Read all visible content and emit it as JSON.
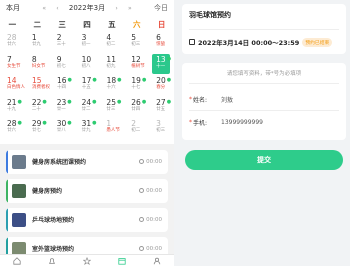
{
  "calendar": {
    "view_label": "本月",
    "prev_year": "«",
    "prev_month": "‹",
    "month_label": "2022年3月",
    "next_month": "›",
    "next_year": "»",
    "today_label": "今日",
    "weekdays": [
      "一",
      "二",
      "三",
      "四",
      "五",
      "六",
      "日"
    ],
    "weeks": [
      [
        {
          "num": "28",
          "sub": "廿六",
          "other": true
        },
        {
          "num": "1",
          "sub": "廿九"
        },
        {
          "num": "2",
          "sub": "三十"
        },
        {
          "num": "3",
          "sub": "初一"
        },
        {
          "num": "4",
          "sub": "初二"
        },
        {
          "num": "5",
          "sub": "初三"
        },
        {
          "num": "6",
          "sub": "惊蛰",
          "sub_red": true
        }
      ],
      [
        {
          "num": "7",
          "sub": "女生节",
          "sub_red": true
        },
        {
          "num": "8",
          "sub": "妇女节",
          "sub_red": true
        },
        {
          "num": "9",
          "sub": "初七"
        },
        {
          "num": "10",
          "sub": "初八"
        },
        {
          "num": "11",
          "sub": "初九"
        },
        {
          "num": "12",
          "sub": "植树节",
          "sub_red": true
        },
        {
          "num": "13",
          "sub": "十一",
          "selected": true,
          "dot": true
        }
      ],
      [
        {
          "num": "14",
          "sub": "白色情人",
          "sub_red": true,
          "num_red": true
        },
        {
          "num": "15",
          "sub": "消费者权",
          "sub_red": true,
          "num_red": true
        },
        {
          "num": "16",
          "sub": "十四",
          "dot": true
        },
        {
          "num": "17",
          "sub": "十五",
          "dot": true
        },
        {
          "num": "18",
          "sub": "十六",
          "dot": true
        },
        {
          "num": "19",
          "sub": "十七",
          "dot": true
        },
        {
          "num": "20",
          "sub": "春分",
          "sub_red": true,
          "dot": true
        }
      ],
      [
        {
          "num": "21",
          "sub": "十九",
          "dot": true
        },
        {
          "num": "22",
          "sub": "二十",
          "dot": true
        },
        {
          "num": "23",
          "sub": "廿一",
          "dot": true
        },
        {
          "num": "24",
          "sub": "廿二",
          "dot": true
        },
        {
          "num": "25",
          "sub": "廿三",
          "dot": true
        },
        {
          "num": "26",
          "sub": "廿四",
          "dot": true
        },
        {
          "num": "27",
          "sub": "廿五",
          "dot": true
        }
      ],
      [
        {
          "num": "28",
          "sub": "廿六",
          "dot": true
        },
        {
          "num": "29",
          "sub": "廿七",
          "dot": true
        },
        {
          "num": "30",
          "sub": "廿八",
          "dot": true
        },
        {
          "num": "31",
          "sub": "廿九",
          "dot": true
        },
        {
          "num": "1",
          "sub": "愚人节",
          "other": true,
          "sub_red": true
        },
        {
          "num": "2",
          "sub": "初二",
          "other": true
        },
        {
          "num": "3",
          "sub": "初三",
          "other": true
        }
      ]
    ]
  },
  "bookings": [
    {
      "name": "健身房系统团课预约",
      "time": "00:00",
      "bar_color": "#3d7be0",
      "thumb_color": "#6b7b8c"
    },
    {
      "name": "健身房预约",
      "time": "00:00",
      "bar_color": "#3db463",
      "thumb_color": "#4a6b4f"
    },
    {
      "name": "乒乓球场地预约",
      "time": "00:00",
      "bar_color": "#2c9fb1",
      "thumb_color": "#3c4f86"
    },
    {
      "name": "室外篮球场预约",
      "time": "00:00",
      "bar_color": "#23a0a0",
      "thumb_color": "#7c8b70"
    }
  ],
  "tabbar": {
    "items": [
      "home-icon",
      "bell-icon",
      "star-icon",
      "calendar-icon",
      "user-icon"
    ]
  },
  "detail": {
    "venue": "羽毛球馆预约",
    "datetime": "2022年3月14日 00:00～23:59",
    "status_tag": "预约已结束",
    "hint": "请您填写资料，带*号为必填项",
    "name_label": "姓名:",
    "name_value": "刘敖",
    "phone_label": "手机:",
    "phone_value": "13999999999",
    "submit_label": "提交"
  },
  "colors": {
    "accent": "#2ecc8b",
    "selected_day": "#2bc88c",
    "holiday_red": "#e74c3c",
    "saturday": "#f39c12"
  }
}
